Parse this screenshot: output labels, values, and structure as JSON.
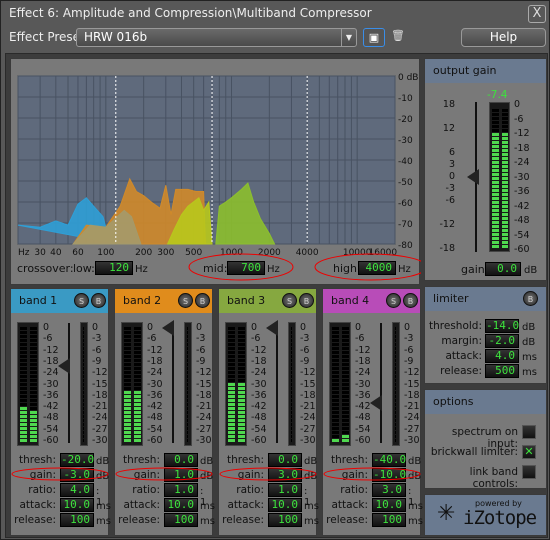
{
  "window": {
    "title": "Effect 6: Amplitude and Compression\\Multiband Compressor",
    "close_label": "X"
  },
  "preset": {
    "label": "Effect Preset:",
    "value": "HRW 016b",
    "save_icon": "floppy-disk-icon",
    "delete_icon": "trash-icon",
    "help_label": "Help"
  },
  "spectrum": {
    "db_ticks": [
      "0 dB",
      "-10",
      "-20",
      "-30",
      "-40",
      "-50",
      "-60",
      "-70",
      "-80"
    ],
    "freq_ticks": [
      {
        "f": 20,
        "label": "Hz"
      },
      {
        "f": 30,
        "label": "30"
      },
      {
        "f": 40,
        "label": "40"
      },
      {
        "f": 60,
        "label": "60"
      },
      {
        "f": 100,
        "label": "100"
      },
      {
        "f": 200,
        "label": "200"
      },
      {
        "f": 300,
        "label": "300"
      },
      {
        "f": 500,
        "label": "500"
      },
      {
        "f": 1000,
        "label": "1000"
      },
      {
        "f": 2000,
        "label": "2000"
      },
      {
        "f": 4000,
        "label": "4000"
      },
      {
        "f": 10000,
        "label": "10000"
      },
      {
        "f": 16000,
        "label": "16000"
      }
    ],
    "freq_range": [
      20,
      20000
    ],
    "db_range": [
      -80,
      0
    ],
    "layers": [
      {
        "color": "#2f9fd6",
        "points": [
          [
            20,
            -71
          ],
          [
            30,
            -72
          ],
          [
            40,
            -69
          ],
          [
            50,
            -71
          ],
          [
            60,
            -61
          ],
          [
            70,
            -58
          ],
          [
            80,
            -62
          ],
          [
            95,
            -67
          ],
          [
            100,
            -72
          ],
          [
            120,
            -72
          ],
          [
            125,
            -80
          ]
        ]
      },
      {
        "color": "#d08a2a",
        "points": [
          [
            55,
            -80
          ],
          [
            70,
            -71
          ],
          [
            100,
            -72
          ],
          [
            130,
            -62
          ],
          [
            155,
            -49
          ],
          [
            175,
            -55
          ],
          [
            200,
            -57
          ],
          [
            230,
            -60
          ],
          [
            270,
            -63
          ],
          [
            300,
            -52
          ],
          [
            330,
            -66
          ],
          [
            360,
            -54
          ],
          [
            450,
            -54
          ],
          [
            520,
            -55
          ],
          [
            600,
            -55
          ],
          [
            620,
            -80
          ]
        ]
      },
      {
        "color": "#a49a6a",
        "points": [
          [
            55,
            -80
          ],
          [
            75,
            -71
          ],
          [
            100,
            -72
          ],
          [
            140,
            -64
          ],
          [
            160,
            -67
          ],
          [
            190,
            -80
          ]
        ]
      },
      {
        "color": "#b8c81c",
        "points": [
          [
            310,
            -80
          ],
          [
            350,
            -73
          ],
          [
            400,
            -66
          ],
          [
            450,
            -62
          ],
          [
            550,
            -58
          ],
          [
            600,
            -64
          ],
          [
            660,
            -60
          ],
          [
            700,
            -80
          ]
        ]
      },
      {
        "color": "#8cbf2e",
        "points": [
          [
            750,
            -80
          ],
          [
            800,
            -62
          ],
          [
            900,
            -60
          ],
          [
            1000,
            -58
          ],
          [
            1200,
            -54
          ],
          [
            1350,
            -51
          ],
          [
            1500,
            -60
          ],
          [
            1700,
            -68
          ],
          [
            2000,
            -75
          ],
          [
            2200,
            -80
          ]
        ]
      }
    ]
  },
  "crossover": {
    "label": "crossover:",
    "low_label": "low:",
    "low": "120",
    "mid_label": "mid:",
    "mid": "700",
    "high_label": "high:",
    "high": "4000",
    "unit": "Hz"
  },
  "bands": [
    {
      "name": "band 1",
      "color": "#3a9ac4",
      "thresh": "-20.0",
      "gain": "-3.0",
      "ratio": "4.0",
      "attack": "10.0",
      "release": "100",
      "thresh_db": -20,
      "level_db": [
        -42,
        -43
      ]
    },
    {
      "name": "band 2",
      "color": "#e08c1c",
      "thresh": "0.0",
      "gain": "1.0",
      "ratio": "1.0",
      "attack": "10.0",
      "release": "100",
      "thresh_db": 0,
      "level_db": [
        -34,
        -34
      ]
    },
    {
      "name": "band 3",
      "color": "#86a840",
      "thresh": "0.0",
      "gain": "3.0",
      "ratio": "1.0",
      "attack": "10.0",
      "release": "100",
      "thresh_db": 0,
      "level_db": [
        -30,
        -28
      ]
    },
    {
      "name": "band 4",
      "color": "#b84cb8",
      "thresh": "-40.0",
      "gain": "-10.0",
      "ratio": "3.0",
      "attack": "10.0",
      "release": "100",
      "thresh_db": -40,
      "level_db": [
        -58,
        -56
      ]
    }
  ],
  "band_labels": {
    "thresh": "thresh:",
    "gain": "gain:",
    "ratio": "ratio:",
    "attack": "attack:",
    "release": "release:",
    "db": "dB",
    "ratio_unit": ": 1",
    "ms": "ms",
    "solo": "S",
    "bypass": "B"
  },
  "band_scale": [
    "0",
    "-6",
    "-12",
    "-18",
    "-24",
    "-30",
    "-36",
    "-42",
    "-48",
    "-54",
    "-60"
  ],
  "gr_scale": [
    "0",
    "-3",
    "-6",
    "-9",
    "-12",
    "-15",
    "-18",
    "-21",
    "-24",
    "-27",
    "-30"
  ],
  "output": {
    "title": "output gain",
    "peak": "-7.4",
    "gain_label": "gain:",
    "gain": "0.0",
    "unit": "dB",
    "level_db": -10,
    "slider_scale": [
      "18",
      "12",
      "6",
      "3",
      "0",
      "-3",
      "-6",
      "-12",
      "-18"
    ],
    "meter_scale": [
      "0",
      "-6",
      "-12",
      "-18",
      "-24",
      "-30",
      "-36",
      "-42",
      "-48",
      "-54",
      "-60"
    ]
  },
  "limiter": {
    "title": "limiter",
    "bypass": "B",
    "threshold_label": "threshold:",
    "threshold": "-14.0",
    "margin_label": "margin:",
    "margin": "-2.0",
    "attack_label": "attack:",
    "attack": "4.0",
    "release_label": "release:",
    "release": "500"
  },
  "options": {
    "title": "options",
    "spectrum_label": "spectrum on input:",
    "spectrum": false,
    "brickwall_label": "brickwall limiter:",
    "brickwall": true,
    "link_label": "link band controls:",
    "link": false
  },
  "logo": {
    "text": "iZotope",
    "tagline": "powered by"
  }
}
